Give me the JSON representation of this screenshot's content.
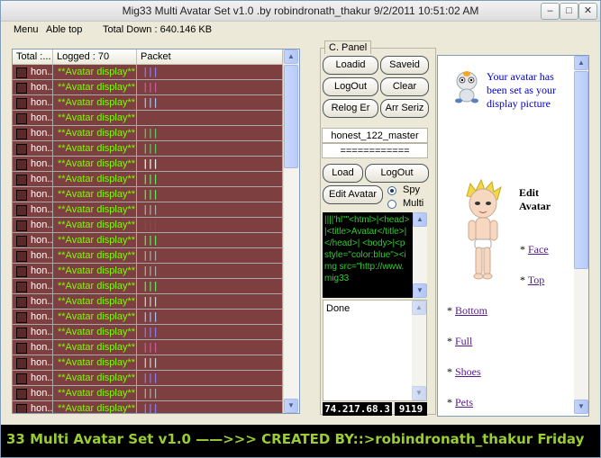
{
  "window": {
    "title": "Mig33 Multi Avatar Set v1.0 .by robindronath_thakur  9/2/2011 10:51:02 AM"
  },
  "menu": {
    "menu_label": "Menu",
    "able_top": "Able top",
    "total_down": "Total Down : 640.146 KB"
  },
  "grid": {
    "headers": [
      "Total :...",
      "Logged : 70",
      "Packet"
    ],
    "rows": [
      {
        "user": "hon...",
        "status": "**Avatar display**",
        "packet": "|||",
        "color": "#8a7cf2"
      },
      {
        "user": "hon...",
        "status": "**Avatar display**",
        "packet": "|||",
        "color": "#d05aa0"
      },
      {
        "user": "hon...",
        "status": "**Avatar display**",
        "packet": "|||",
        "color": "#9fc3f0"
      },
      {
        "user": "hon...",
        "status": "**Avatar display**",
        "packet": "",
        "color": "#000000"
      },
      {
        "user": "hon...",
        "status": "**Avatar display**",
        "packet": "|||",
        "color": "#5fc85f"
      },
      {
        "user": "hon...",
        "status": "**Avatar display**",
        "packet": "|||",
        "color": "#5fc85f"
      },
      {
        "user": "hon...",
        "status": "**Avatar display**",
        "packet": "|||",
        "color": "#f0f0f0"
      },
      {
        "user": "hon...",
        "status": "**Avatar display**",
        "packet": "|||",
        "color": "#5fe85f"
      },
      {
        "user": "hon...",
        "status": "**Avatar display**",
        "packet": "|||",
        "color": "#5fe85f"
      },
      {
        "user": "hon...",
        "status": "**Avatar display**",
        "packet": "|||",
        "color": "#aaaaaa"
      },
      {
        "user": "hon...",
        "status": "**Avatar display**",
        "packet": "|||",
        "color": "#8a4a4a"
      },
      {
        "user": "hon...",
        "status": "**Avatar display**",
        "packet": "|||",
        "color": "#5fe85f"
      },
      {
        "user": "hon...",
        "status": "**Avatar display**",
        "packet": "|||",
        "color": "#aaaaaa"
      },
      {
        "user": "hon...",
        "status": "**Avatar display**",
        "packet": "|||",
        "color": "#aaaaaa"
      },
      {
        "user": "hon...",
        "status": "**Avatar display**",
        "packet": "|||",
        "color": "#5fe85f"
      },
      {
        "user": "hon...",
        "status": "**Avatar display**",
        "packet": "|||",
        "color": "#d0d0d0"
      },
      {
        "user": "hon...",
        "status": "**Avatar display**",
        "packet": "|||",
        "color": "#9fc3f0"
      },
      {
        "user": "hon...",
        "status": "**Avatar display**",
        "packet": "|||",
        "color": "#8a7cf2"
      },
      {
        "user": "hon...",
        "status": "**Avatar display**",
        "packet": "|||",
        "color": "#d05aa0"
      },
      {
        "user": "hon...",
        "status": "**Avatar display**",
        "packet": "|||",
        "color": "#d0d0d0"
      },
      {
        "user": "hon...",
        "status": "**Avatar display**",
        "packet": "|||",
        "color": "#8a7cf2"
      },
      {
        "user": "hon...",
        "status": "**Avatar display**",
        "packet": "|||",
        "color": "#aaaaaa"
      },
      {
        "user": "hon...",
        "status": "**Avatar display**",
        "packet": "|||",
        "color": "#8a7cf2"
      },
      {
        "user": "hon...",
        "status": "**Avatar display**",
        "packet": "|||",
        "color": "#8a7cf2"
      }
    ]
  },
  "panel": {
    "tab_label": "C. Panel",
    "loadid": "Loadid",
    "saveid": "Saveid",
    "logout": "LogOut",
    "clear": "Clear",
    "relog_er": "Relog Er",
    "arr_seriz": "Arr Seriz",
    "username": "honest_122_master",
    "password": "============",
    "load": "Load",
    "logout2": "LogOut",
    "edit_avatar": "Edit Avatar",
    "spy": "Spy",
    "multi": "Multi",
    "code": "||||'hl\"\"<html>|<head>|<title>Avatar</title>|</head>|    <body>|<p style=\"color:blue\"><img src=\"http://www.mig33",
    "log": "Done",
    "ip": "74.217.68.3",
    "port": "9119"
  },
  "webview": {
    "message": "Your avatar has been set as your display picture",
    "edit_avatar": "Edit Avatar",
    "links": [
      "Face",
      "Top",
      "Bottom",
      "Full",
      "Shoes",
      "Pets"
    ]
  },
  "statusbar": {
    "text": "33 Multi Avatar Set v1.0 ——>>> CREATED BY::>robindronath_thakur   Friday"
  }
}
